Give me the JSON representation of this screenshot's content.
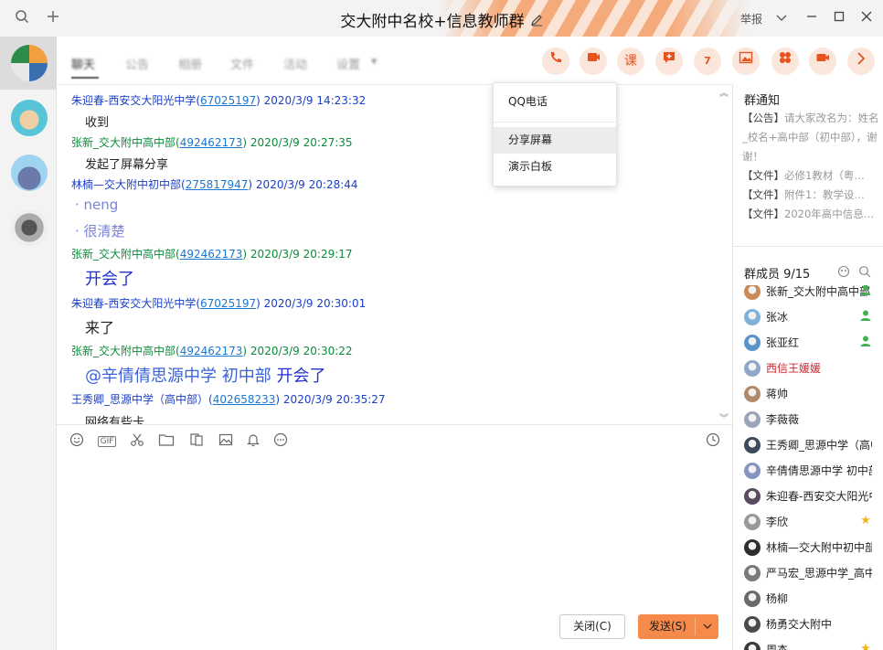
{
  "window": {
    "title": "交大附中名校+信息教师群",
    "report_label": "举报"
  },
  "tabs": [
    "聊天",
    "公告",
    "相册",
    "文件",
    "活动",
    "设置"
  ],
  "toolbar_icons": [
    "phone-icon",
    "screen-share-icon",
    "lesson-icon",
    "discussion-icon",
    "calendar-icon",
    "picture-icon",
    "apps-icon",
    "video-icon",
    "more-icon"
  ],
  "toolbar_lesson_glyph": "课",
  "toolbar_calendar_glyph": "7",
  "dropdown": {
    "items": [
      "QQ电话",
      "分享屏幕",
      "演示白板"
    ]
  },
  "messages": [
    {
      "name": "朱迎春-西安交大阳光中学",
      "account": "67025197",
      "time": "2020/3/9 14:23:32",
      "color": "blue",
      "body": "收到"
    },
    {
      "name": "张新_交大附中高中部",
      "account": "492462173",
      "time": "2020/3/9 20:27:35",
      "color": "green",
      "body": "发起了屏幕分享"
    },
    {
      "name": "林楠—交大附中初中部",
      "account": "275817947",
      "time": "2020/3/9 20:28:44",
      "color": "blue",
      "body_lines": [
        "neng",
        "很清楚"
      ]
    },
    {
      "name": "张新_交大附中高中部",
      "account": "492462173",
      "time": "2020/3/9 20:29:17",
      "color": "green",
      "body": "开会了"
    },
    {
      "name": "朱迎春-西安交大阳光中学",
      "account": "67025197",
      "time": "2020/3/9 20:30:01",
      "color": "blue",
      "body": "来了"
    },
    {
      "name": "张新_交大附中高中部",
      "account": "492462173",
      "time": "2020/3/9 20:30:22",
      "color": "green",
      "mention": "@辛倩倩思源中学 初中部",
      "body": "开会了"
    },
    {
      "name": "王秀卿_思源中学（高中部）",
      "account": "402658233",
      "time": "2020/3/9 20:35:27",
      "color": "blue",
      "body": "网络有些卡"
    }
  ],
  "input_toolbar": [
    "emoji-icon",
    "gif-icon",
    "scissors-icon",
    "folder-icon",
    "document-icon",
    "image-icon",
    "bell-icon",
    "more-dots-icon"
  ],
  "input_gif_label": "GIF",
  "buttons": {
    "close": "关闭(C)",
    "send": "发送(S)"
  },
  "notice": {
    "title": "群通知",
    "announcement_tag": "【公告】",
    "announcement": "请大家改名为：姓名_校名+高中部（初中部），谢谢！",
    "files": [
      {
        "tag": "【文件】",
        "name": "必修1教材（粤…"
      },
      {
        "tag": "【文件】",
        "name": "附件1：教学设…"
      },
      {
        "tag": "【文件】",
        "name": "2020年高中信息…"
      }
    ]
  },
  "members": {
    "title": "群成员 9/15",
    "list": [
      {
        "name": "张新_交大附中高中部",
        "badge": "person",
        "style": ""
      },
      {
        "name": "张冰",
        "badge": "person",
        "style": ""
      },
      {
        "name": "张亚红",
        "badge": "person",
        "style": ""
      },
      {
        "name": "西信王媛媛",
        "badge": "",
        "style": "red"
      },
      {
        "name": "蒋帅",
        "badge": "",
        "style": ""
      },
      {
        "name": "李薇薇",
        "badge": "",
        "style": ""
      },
      {
        "name": "王秀卿_思源中学（高中部）",
        "badge": "",
        "style": ""
      },
      {
        "name": "辛倩倩思源中学 初中部",
        "badge": "",
        "style": ""
      },
      {
        "name": "朱迎春-西安交大阳光中学",
        "badge": "",
        "style": ""
      },
      {
        "name": "李欣",
        "badge": "star",
        "style": ""
      },
      {
        "name": "林楠—交大附中初中部",
        "badge": "",
        "style": ""
      },
      {
        "name": "严马宏_思源中学_高中部",
        "badge": "",
        "style": ""
      },
      {
        "name": "杨柳",
        "badge": "",
        "style": ""
      },
      {
        "name": "杨勇交大附中",
        "badge": "",
        "style": ""
      },
      {
        "name": "周杰",
        "badge": "star",
        "style": ""
      }
    ]
  }
}
